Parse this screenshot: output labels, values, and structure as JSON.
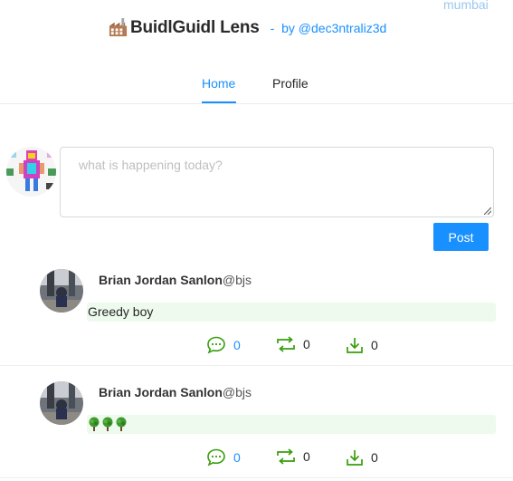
{
  "network": "mumbai",
  "brand": {
    "icon": "factory-icon",
    "title": "BuidlGuidl Lens",
    "byline": "-  by @dec3ntraliz3d"
  },
  "tabs": [
    {
      "label": "Home",
      "active": true
    },
    {
      "label": "Profile",
      "active": false
    }
  ],
  "composer": {
    "placeholder": "what is happening today?",
    "post_label": "Post"
  },
  "posts": [
    {
      "author": "Brian Jordan Sanlon",
      "handle": "@bjs",
      "content": "Greedy boy",
      "comments": "0",
      "mirrors": "0",
      "collects": "0"
    },
    {
      "author": "Brian Jordan Sanlon",
      "handle": "@bjs",
      "content": "🌳🌳🌳",
      "content_icons": [
        "tree-icon",
        "tree-icon",
        "tree-icon"
      ],
      "comments": "0",
      "mirrors": "0",
      "collects": "0"
    }
  ],
  "colors": {
    "accent": "#1890ff",
    "action_green": "#389e0d",
    "content_bg": "#edfaed"
  }
}
